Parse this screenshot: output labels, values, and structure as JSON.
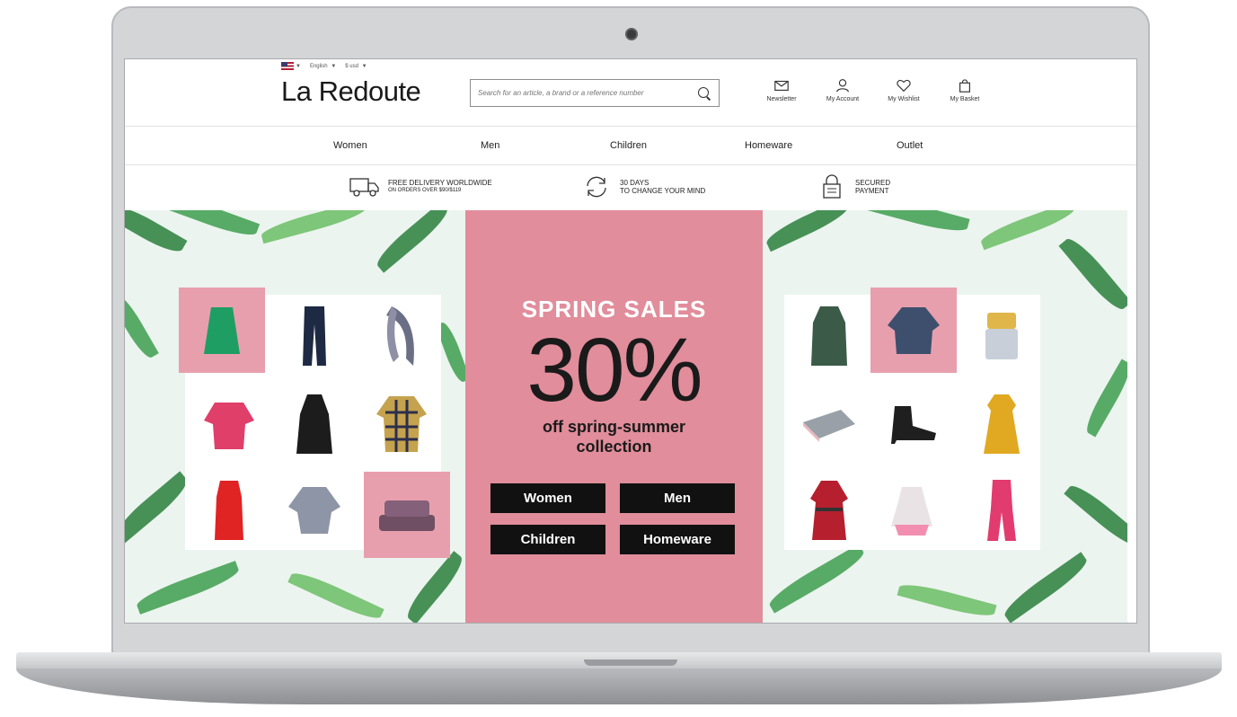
{
  "topbar": {
    "language": "English",
    "currency": "$ usd"
  },
  "header": {
    "logo": "La Redoute",
    "search_placeholder": "Search for an article, a brand or a reference number",
    "icons": [
      {
        "label": "Newsletter",
        "icon": "envelope-icon"
      },
      {
        "label": "My Account",
        "icon": "user-icon"
      },
      {
        "label": "My Wishlist",
        "icon": "heart-icon"
      },
      {
        "label": "My Basket",
        "icon": "bag-icon"
      }
    ]
  },
  "nav": {
    "items": [
      "Women",
      "Men",
      "Children",
      "Homeware",
      "Outlet"
    ]
  },
  "services": [
    {
      "line1": "FREE DELIVERY WORLDWIDE",
      "line2": "ON ORDERS OVER $90/$119",
      "icon": "truck-icon"
    },
    {
      "line1": "30 DAYS",
      "line2": "TO CHANGE YOUR MIND",
      "icon": "refresh-icon"
    },
    {
      "line1": "SECURED",
      "line2": "PAYMENT",
      "icon": "lock-icon"
    }
  ],
  "banner": {
    "headline": "SPRING SALES",
    "percent": "30%",
    "subtitle_line1": "off spring-summer",
    "subtitle_line2": "collection",
    "ctas": [
      "Women",
      "Men",
      "Children",
      "Homeware"
    ]
  },
  "colors": {
    "pink": "#e18d9b",
    "tile_pink": "#e89fad",
    "black": "#111111",
    "leaf_green": "#3e9e4e"
  }
}
